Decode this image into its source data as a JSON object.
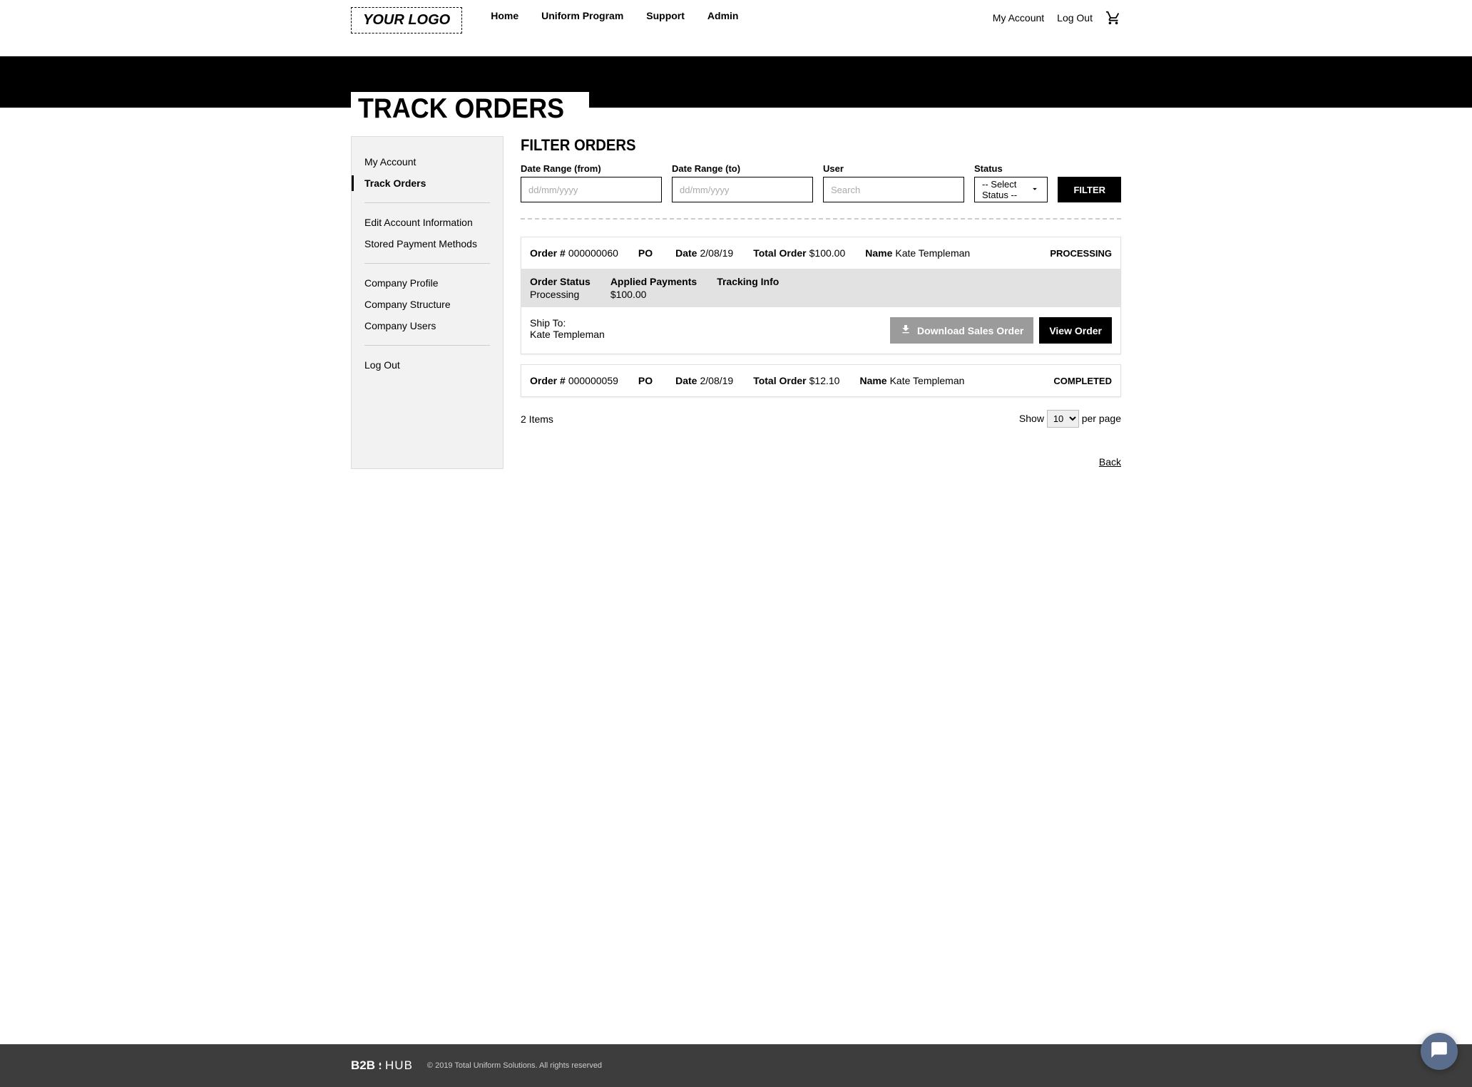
{
  "header": {
    "logo": "YOUR LOGO",
    "nav": {
      "home": "Home",
      "uniform": "Uniform Program",
      "support": "Support",
      "admin": "Admin"
    },
    "right": {
      "account": "My Account",
      "logout": "Log Out"
    }
  },
  "page_title": "TRACK ORDERS",
  "sidebar": {
    "items": [
      {
        "label": "My Account"
      },
      {
        "label": "Track Orders"
      },
      {
        "label": "Edit Account Information"
      },
      {
        "label": "Stored Payment Methods"
      },
      {
        "label": "Company Profile"
      },
      {
        "label": "Company Structure"
      },
      {
        "label": "Company Users"
      },
      {
        "label": "Log Out"
      }
    ]
  },
  "filters": {
    "heading": "FILTER ORDERS",
    "date_from_label": "Date Range (from)",
    "date_from_placeholder": "dd/mm/yyyy",
    "date_to_label": "Date Range (to)",
    "date_to_placeholder": "dd/mm/yyyy",
    "user_label": "User",
    "user_placeholder": "Search",
    "status_label": "Status",
    "status_selected": "-- Select Status --",
    "button": "FILTER"
  },
  "labels": {
    "order_no": "Order #",
    "po": "PO",
    "date": "Date",
    "total_order": "Total Order",
    "name": "Name",
    "order_status": "Order Status",
    "applied_payments": "Applied Payments",
    "tracking_info": "Tracking Info",
    "ship_to": "Ship To:",
    "download": "Download Sales Order",
    "view": "View Order",
    "items_count": "2 Items",
    "show": "Show",
    "page_size_value": "10",
    "per_page": "per page",
    "back": "Back"
  },
  "orders": [
    {
      "number": "000000060",
      "po": "",
      "date": "2/08/19",
      "total": "$100.00",
      "name": "Kate Templeman",
      "status_badge": "PROCESSING",
      "order_status": "Processing",
      "applied_payments": "$100.00",
      "tracking_info": "",
      "ship_to_name": "Kate Templeman"
    },
    {
      "number": "000000059",
      "po": "",
      "date": "2/08/19",
      "total": "$12.10",
      "name": "Kate Templeman",
      "status_badge": "COMPLETED"
    }
  ],
  "footer": {
    "brand_b2b": "B2B",
    "brand_hub": "HUB",
    "copy": "© 2019 Total Uniform Solutions. All rights reserved"
  }
}
